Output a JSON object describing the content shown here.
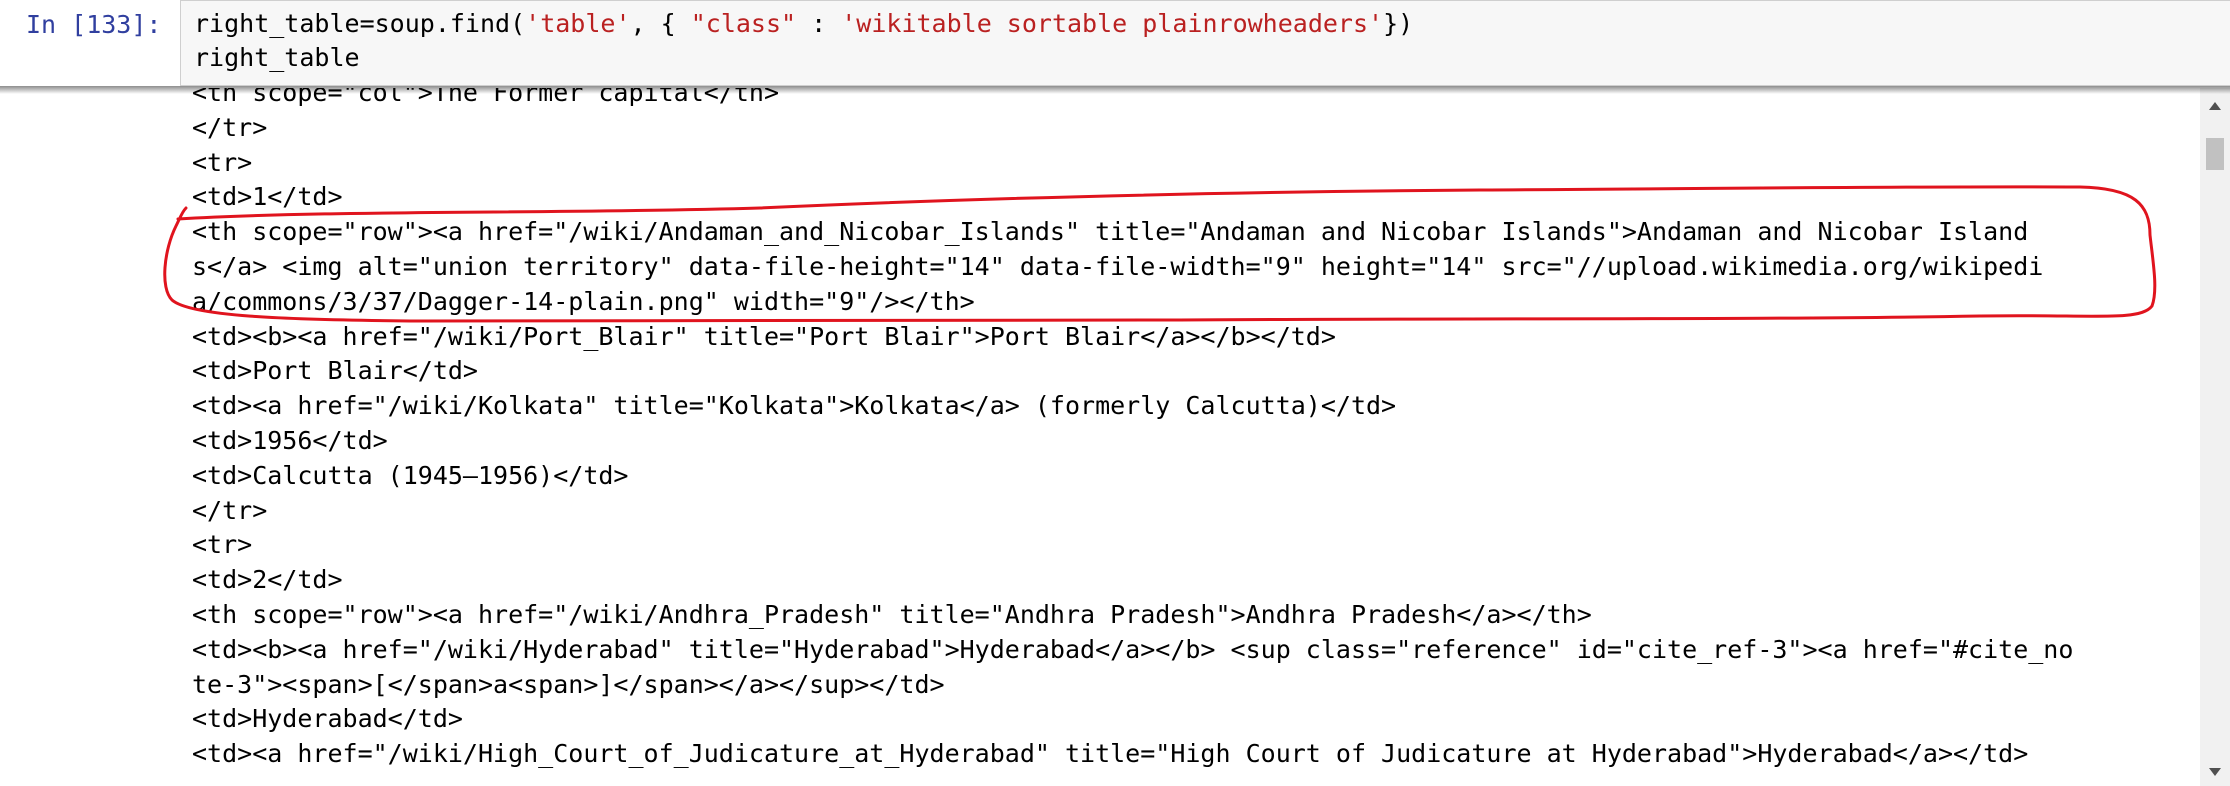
{
  "cell": {
    "prompt": "In [133]:",
    "code": {
      "line1_a": "right_table=soup.find(",
      "line1_s1": "'table'",
      "line1_b": ", { ",
      "line1_s2": "\"class\"",
      "line1_c": " : ",
      "line1_s3": "'wikitable sortable plainrowheaders'",
      "line1_d": "})",
      "line2": "right_table"
    }
  },
  "output": {
    "lines": [
      "<th scope=\"col\">The Former capital</th>",
      "</tr>",
      "<tr>",
      "<td>1</td>",
      "<th scope=\"row\"><a href=\"/wiki/Andaman_and_Nicobar_Islands\" title=\"Andaman and Nicobar Islands\">Andaman and Nicobar Island",
      "s</a> <img alt=\"union territory\" data-file-height=\"14\" data-file-width=\"9\" height=\"14\" src=\"//upload.wikimedia.org/wikipedi",
      "a/commons/3/37/Dagger-14-plain.png\" width=\"9\"/></th>",
      "<td><b><a href=\"/wiki/Port_Blair\" title=\"Port Blair\">Port Blair</a></b></td>",
      "<td>Port Blair</td>",
      "<td><a href=\"/wiki/Kolkata\" title=\"Kolkata\">Kolkata</a> (formerly Calcutta)</td>",
      "<td>1956</td>",
      "<td>Calcutta (1945–1956)</td>",
      "</tr>",
      "<tr>",
      "<td>2</td>",
      "<th scope=\"row\"><a href=\"/wiki/Andhra_Pradesh\" title=\"Andhra Pradesh\">Andhra Pradesh</a></th>",
      "<td><b><a href=\"/wiki/Hyderabad\" title=\"Hyderabad\">Hyderabad</a></b> <sup class=\"reference\" id=\"cite_ref-3\"><a href=\"#cite_no",
      "te-3\"><span>[</span>a<span>]</span></a></sup></td>",
      "<td>Hyderabad</td>",
      "<td><a href=\"/wiki/High_Court_of_Judicature_at_Hyderabad\" title=\"High Court of Judicature at Hyderabad\">Hyderabad</a></td>"
    ]
  },
  "annotation": {
    "color": "#e0141e"
  },
  "scrollbar": {
    "up_icon": "scroll-up-arrow-icon",
    "down_icon": "scroll-down-arrow-icon"
  }
}
